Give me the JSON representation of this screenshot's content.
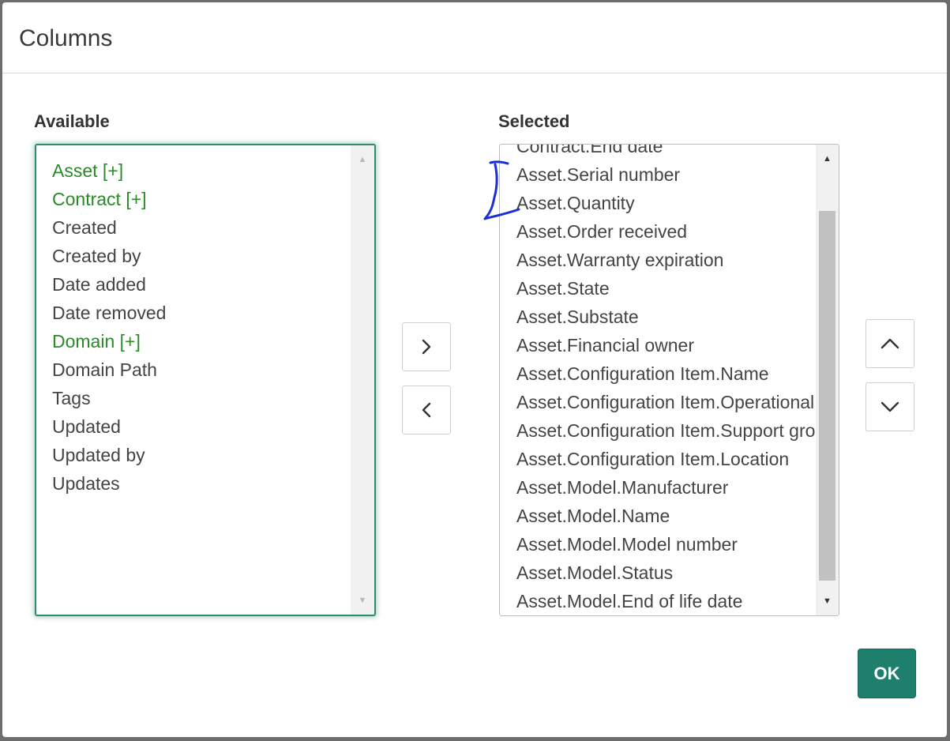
{
  "dialog": {
    "title": "Columns",
    "ok_label": "OK"
  },
  "available": {
    "label": "Available",
    "items": [
      {
        "text": "Asset [+]",
        "group": true
      },
      {
        "text": "Contract [+]",
        "group": true
      },
      {
        "text": "Created",
        "group": false
      },
      {
        "text": "Created by",
        "group": false
      },
      {
        "text": "Date added",
        "group": false
      },
      {
        "text": "Date removed",
        "group": false
      },
      {
        "text": "Domain [+]",
        "group": true
      },
      {
        "text": "Domain Path",
        "group": false
      },
      {
        "text": "Tags",
        "group": false
      },
      {
        "text": "Updated",
        "group": false
      },
      {
        "text": "Updated by",
        "group": false
      },
      {
        "text": "Updates",
        "group": false
      }
    ]
  },
  "selected": {
    "label": "Selected",
    "items": [
      "Contract.End date",
      "Asset.Serial number",
      "Asset.Quantity",
      "Asset.Order received",
      "Asset.Warranty expiration",
      "Asset.State",
      "Asset.Substate",
      "Asset.Financial owner",
      "Asset.Configuration Item.Name",
      "Asset.Configuration Item.Operational status",
      "Asset.Configuration Item.Support group",
      "Asset.Configuration Item.Location",
      "Asset.Model.Manufacturer",
      "Asset.Model.Name",
      "Asset.Model.Model number",
      "Asset.Model.Status",
      "Asset.Model.End of life date"
    ]
  },
  "icons": {
    "add": "chevron-right-icon",
    "remove": "chevron-left-icon",
    "move_up": "chevron-up-icon",
    "move_down": "chevron-down-icon"
  },
  "colors": {
    "accent": "#1f7f6d",
    "group_item": "#2a8a2a",
    "focus_border": "#2e8b6e",
    "annotation_ink": "#1a2fd6"
  }
}
